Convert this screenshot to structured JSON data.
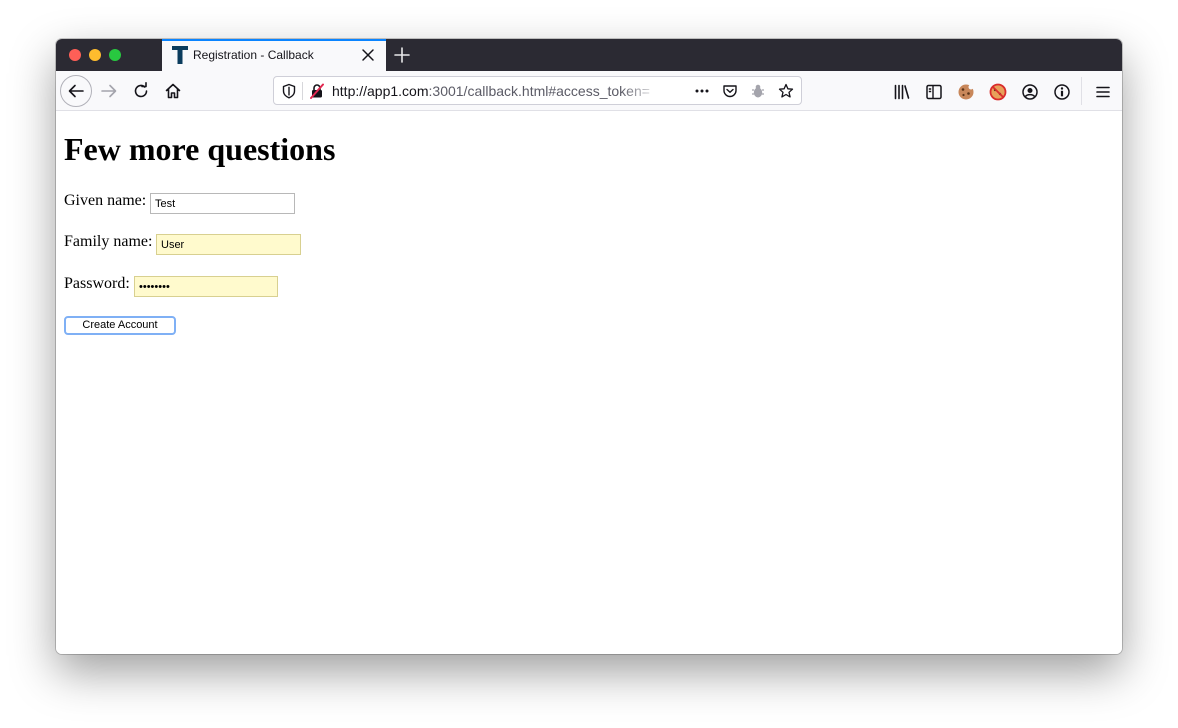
{
  "browser": {
    "tab": {
      "title": "Registration - Callback",
      "favicon": "t-logo-icon"
    },
    "url": {
      "host": "http://app1.com",
      "rest": ":3001/callback.html#access_token=",
      "full": "http://app1.com:3001/callback.html#access_token="
    },
    "toolbar_icons": [
      "library-icon",
      "sidebar-icon",
      "cookie-extension-icon",
      "blocked-cookie-extension-icon",
      "account-icon",
      "info-extension-icon",
      "menu-icon"
    ],
    "accent_color": "#0a84ff"
  },
  "page": {
    "title": "Few more questions",
    "given_name": {
      "label": "Given name:",
      "value": "Test"
    },
    "family_name": {
      "label": "Family name:",
      "value": "User"
    },
    "password": {
      "label": "Password:",
      "value": "••••••••"
    },
    "submit_label": "Create Account",
    "autofill_color": "#fffacd"
  }
}
